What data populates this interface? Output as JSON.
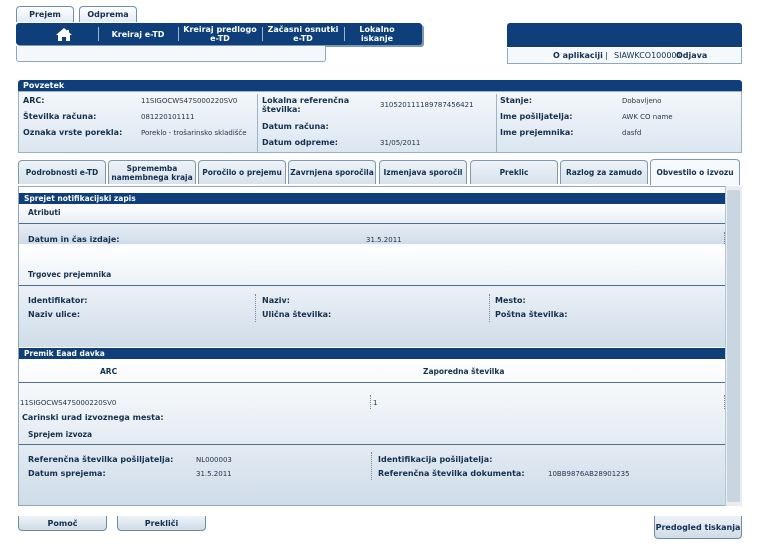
{
  "top_tabs": [
    "Prejem",
    "Odprema"
  ],
  "nav": [
    "Kreiraj e-TD",
    "Kreiraj predlogo e-TD",
    "Začasni osnutki e-TD",
    "Lokalno iskanje"
  ],
  "right_menu": {
    "about": "O aplikaciji",
    "separator": "|",
    "user": "SIAWKCO100001",
    "logout": "Odjava"
  },
  "summary": {
    "title": "Povzetek",
    "arc_label": "ARC:",
    "arc_value": "11SIGOCWS47S000220SV0",
    "invoice_number_label": "Številka računa:",
    "invoice_number_value": "081220101111",
    "origin_type_label": "Oznaka vrste porekla:",
    "origin_type_value": "Poreklo - trošarinsko skladišče",
    "local_ref_label": "Lokalna referenčna številka:",
    "local_ref_value": "310520111189787456421",
    "invoice_date_label": "Datum računa:",
    "invoice_date_value": "",
    "dispatch_date_label": "Datum odpreme:",
    "dispatch_date_value": "31/05/2011",
    "state_label": "Stanje:",
    "state_value": "Dobavljeno",
    "consignor_label": "Ime pošiljatelja:",
    "consignor_value": "AWK CO name",
    "consignee_label": "Ime prejemnika:",
    "consignee_value": "dasfd"
  },
  "detail_tabs": [
    "Podrobnosti e-TD",
    "Sprememba namembnega kraja",
    "Poročilo o prejemu",
    "Zavrnjena sporočila",
    "Izmenjava sporočil",
    "Preklic",
    "Razlog za zamudo",
    "Obvestilo o izvozu"
  ],
  "content": {
    "section1_title": "Sprejet notifikacijski zapis",
    "attributes_label": "Atributi",
    "issue_datetime_label": "Datum in čas izdaje:",
    "issue_datetime_value": "31.5.2011",
    "trader_label": "Trgovec prejemnika",
    "identifier_label": "Identifikator:",
    "name_label": "Naziv:",
    "city_label": "Mesto:",
    "street_name_label": "Naziv ulice:",
    "street_number_label": "Ulična številka:",
    "postal_code_label": "Poštna številka:",
    "section2_title": "Premik Eaad davka",
    "col_arc": "ARC",
    "col_seq": "Zaporedna številka",
    "row_arc": "11SIGOCWS47S000220SV0",
    "row_seq": "1",
    "customs_office_label": "Carinski urad izvoznega mesta:",
    "export_acceptance_label": "Sprejem izvoza",
    "consignor_ref_label": "Referenčna številka pošiljatelja:",
    "consignor_ref_value": "NL000003",
    "consignor_id_label": "Identifikacija pošiljatelja:",
    "acceptance_date_label": "Datum sprejema:",
    "acceptance_date_value": "31.5.2011",
    "doc_ref_label": "Referenčna številka dokumenta:",
    "doc_ref_value": "10BB9876AB28901235"
  },
  "bottom_buttons": {
    "help": "Pomoč",
    "cancel": "Prekliči",
    "print_preview": "Predogled tiskanja"
  }
}
